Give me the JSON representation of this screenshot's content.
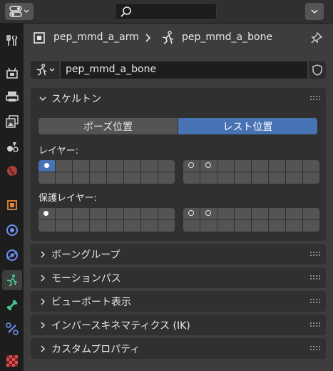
{
  "colors": {
    "accent": "#4772b3",
    "bone_icon": "#48c48c"
  },
  "breadcrumb": {
    "armature": "pep_mmd_a_arm",
    "bone": "pep_mmd_a_bone"
  },
  "bone_field": {
    "value": "pep_mmd_a_bone"
  },
  "skeleton": {
    "title": "スケルトン",
    "pose_button": "ポーズ位置",
    "rest_button": "レスト位置",
    "layers_label": "レイヤー:",
    "protected_label": "保護レイヤー:"
  },
  "collapsed_panels": [
    "ボーングループ",
    "モーションパス",
    "ビューポート表示",
    "インバースキネマティクス (IK)",
    "カスタムプロパティ"
  ],
  "tabs": [
    "tool-icon",
    "render-icon",
    "output-icon",
    "view-layer-icon",
    "scene-icon",
    "world-icon",
    "object-icon",
    "modifier-icon",
    "physics-icon",
    "object-data-icon",
    "bone-icon",
    "bone-constraint-icon",
    "texture-icon"
  ]
}
